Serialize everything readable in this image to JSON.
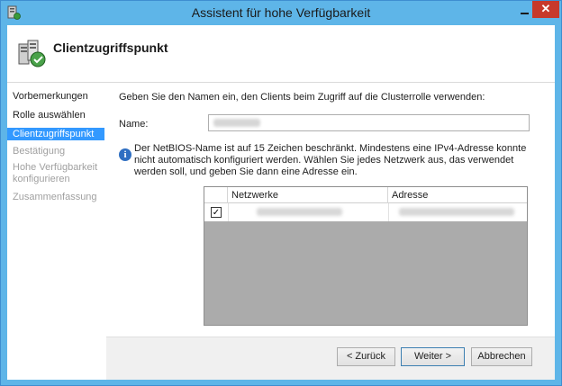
{
  "window": {
    "title": "Assistent für hohe Verfügbarkeit",
    "close_glyph": "✕"
  },
  "header": {
    "title": "Clientzugriffspunkt",
    "icon": "cluster-wizard-icon"
  },
  "nav": {
    "items": [
      {
        "label": "Vorbemerkungen",
        "state": "normal"
      },
      {
        "label": "Rolle auswählen",
        "state": "normal"
      },
      {
        "label": "Clientzugriffspunkt",
        "state": "selected"
      },
      {
        "label": "Bestätigung",
        "state": "disabled"
      },
      {
        "label": "Hohe Verfügbarkeit konfigurieren",
        "state": "disabled"
      },
      {
        "label": "Zusammenfassung",
        "state": "disabled"
      }
    ]
  },
  "main": {
    "intro": "Geben Sie den Namen ein, den Clients beim Zugriff auf die Clusterrolle verwenden:",
    "name_label": "Name:",
    "info_text": "Der NetBIOS-Name ist auf 15 Zeichen beschränkt.  Mindestens eine IPv4-Adresse konnte nicht automatisch konfiguriert werden. Wählen Sie jedes Netzwerk aus, das verwendet werden soll, und geben Sie dann eine Adresse ein.",
    "grid": {
      "columns": [
        "Netzwerke",
        "Adresse"
      ],
      "rows": [
        {
          "checked": true,
          "check_glyph": "✓"
        }
      ]
    }
  },
  "buttons": {
    "back": "< Zurück",
    "next": "Weiter >",
    "cancel": "Abbrechen"
  },
  "colors": {
    "titlebar": "#5eb5e8",
    "selected": "#3399ff",
    "close": "#c7392b"
  }
}
